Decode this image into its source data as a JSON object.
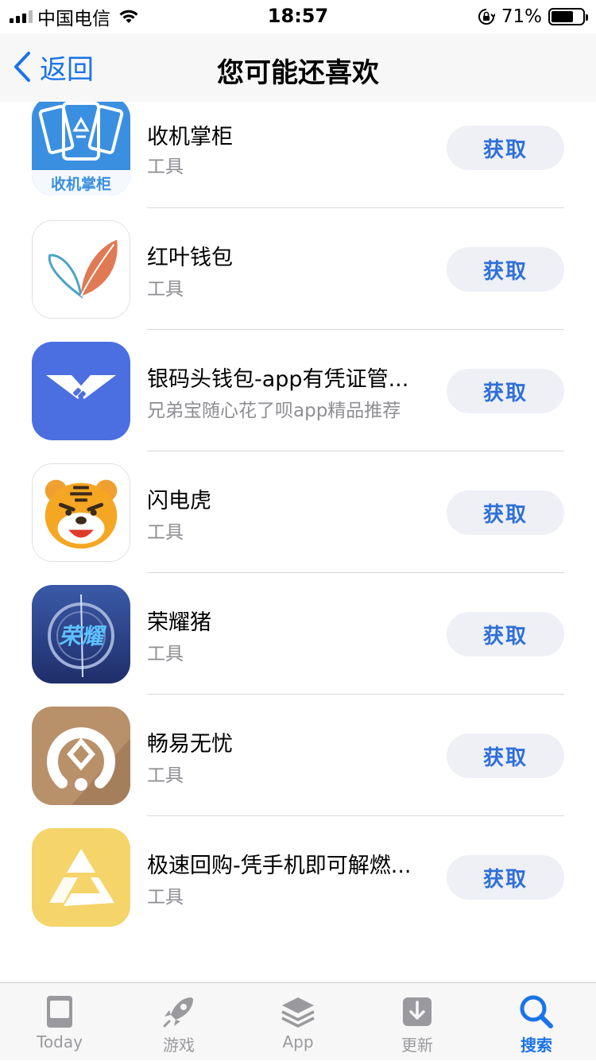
{
  "status_bar": {
    "carrier": "中国电信",
    "time": "18:57",
    "battery": "71%"
  },
  "nav": {
    "back_label": "返回",
    "title": "您可能还喜欢"
  },
  "get_label": "获取",
  "apps": [
    {
      "name": "收机掌柜",
      "subtitle": "工具",
      "icon_text": "收机掌柜"
    },
    {
      "name": "红叶钱包",
      "subtitle": "工具"
    },
    {
      "name": "银码头钱包-app有凭证管...",
      "subtitle": "兄弟宝随心花了呗app精品推荐"
    },
    {
      "name": "闪电虎",
      "subtitle": "工具"
    },
    {
      "name": "荣耀猪",
      "subtitle": "工具",
      "icon_text": "荣耀"
    },
    {
      "name": "畅易无忧",
      "subtitle": "工具"
    },
    {
      "name": "极速回购-凭手机即可解燃...",
      "subtitle": "工具"
    }
  ],
  "tabs": [
    {
      "label": "Today",
      "icon": "today-icon"
    },
    {
      "label": "游戏",
      "icon": "rocket-icon"
    },
    {
      "label": "App",
      "icon": "layers-icon"
    },
    {
      "label": "更新",
      "icon": "download-icon"
    },
    {
      "label": "搜索",
      "icon": "search-icon",
      "active": true
    }
  ],
  "colors": {
    "accent": "#1a73e8",
    "button_bg": "#eef0f6",
    "button_text": "#2f6fd8",
    "secondary_text": "#8e8e93"
  }
}
